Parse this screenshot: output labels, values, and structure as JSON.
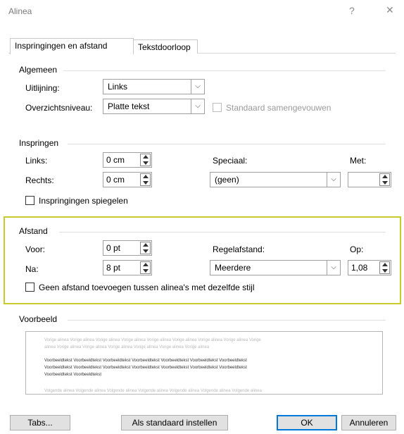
{
  "dialog": {
    "title": "Alinea",
    "help": "?",
    "close": "✕"
  },
  "tabs": [
    {
      "label": "Inspringingen en afstand",
      "active": true
    },
    {
      "label": "Tekstdoorloop",
      "active": false
    }
  ],
  "general": {
    "title": "Algemeen",
    "alignment_label": "Uitlijning:",
    "alignment_value": "Links",
    "outline_label": "Overzichtsniveau:",
    "outline_value": "Platte tekst",
    "collapsed_label": "Standaard samengevouwen"
  },
  "indent": {
    "title": "Inspringen",
    "left_label": "Links:",
    "left_value": "0 cm",
    "right_label": "Rechts:",
    "right_value": "0 cm",
    "special_label": "Speciaal:",
    "special_value": "(geen)",
    "by_label": "Met:",
    "by_value": "",
    "mirror_label": "Inspringingen spiegelen"
  },
  "spacing": {
    "title": "Afstand",
    "before_label": "Voor:",
    "before_value": "0 pt",
    "after_label": "Na:",
    "after_value": "8 pt",
    "line_label": "Regelafstand:",
    "line_value": "Meerdere",
    "at_label": "Op:",
    "at_value": "1,08",
    "no_space_label": "Geen afstand toevoegen tussen alinea's met dezelfde stijl"
  },
  "preview": {
    "title": "Voorbeeld",
    "prev_1": "Vorige alinea Vorige alinea Vorige alinea Vorige alinea Vorige alinea Vorige alinea Vorige alinea Vorige alinea Vorige",
    "prev_2": "alinea Vorige alinea Vorige alinea Vorige alinea Vorige alinea Vorige alinea Vorige alinea",
    "sample_1": "Voorbeeldtekst Voorbeeldtekst Voorbeeldtekst Voorbeeldtekst Voorbeeldtekst Voorbeeldtekst Voorbeeldtekst",
    "sample_2": "Voorbeeldtekst Voorbeeldtekst Voorbeeldtekst Voorbeeldtekst Voorbeeldtekst Voorbeeldtekst Voorbeeldtekst",
    "sample_3": "Voorbeeldtekst Voorbeeldtekst",
    "next_1": "Volgende alinea Volgende alinea Volgende alinea Volgende alinea Volgende alinea Volgende alinea Volgende alinea"
  },
  "buttons": {
    "tabs": "Tabs...",
    "default": "Als standaard instellen",
    "ok": "OK",
    "cancel": "Annuleren"
  },
  "colors": {
    "highlight": "#c8cc2a",
    "default_button": "#0078d7"
  }
}
